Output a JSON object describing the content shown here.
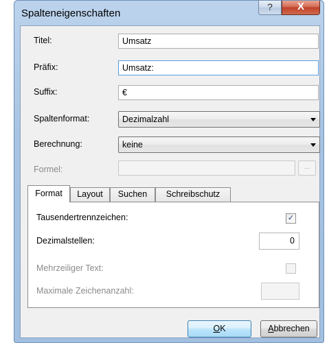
{
  "window": {
    "title": "Spalteneigenschaften",
    "help_glyph": "?",
    "close_glyph": "X"
  },
  "fields": {
    "titel": {
      "label": "Titel:",
      "value": "Umsatz"
    },
    "praefix": {
      "label": "Präfix:",
      "value": "Umsatz:"
    },
    "suffix": {
      "label": "Suffix:",
      "value": "€"
    },
    "spaltenformat": {
      "label": "Spaltenformat:",
      "value": "Dezimalzahl"
    },
    "berechnung": {
      "label": "Berechnung:",
      "value": "keine"
    },
    "formel": {
      "label": "Formel:",
      "value": "",
      "button": "..."
    }
  },
  "tabs": [
    {
      "label": "Format",
      "active": true
    },
    {
      "label": "Layout",
      "active": false
    },
    {
      "label": "Suchen",
      "active": false
    },
    {
      "label": "Schreibschutz",
      "active": false
    }
  ],
  "format_tab": {
    "tausendertrennzeichen": {
      "label": "Tausendertrennzeichen:",
      "checked": true,
      "check_glyph": "✓"
    },
    "dezimalstellen": {
      "label": "Dezimalstellen:",
      "value": "0"
    },
    "mehrzeilig": {
      "label": "Mehrzeiliger Text:",
      "checked": false
    },
    "maxzeichen": {
      "label": "Maximale Zeichenanzahl:",
      "value": ""
    }
  },
  "buttons": {
    "ok": {
      "mnemonic": "O",
      "rest": "K"
    },
    "abbrechen": {
      "mnemonic": "A",
      "rest": "bbrechen"
    }
  },
  "colors": {
    "frame": "#a8c3e2",
    "close": "#c0412a",
    "dialog_bg": "#f0f0f0",
    "focus_border": "#569de5"
  }
}
